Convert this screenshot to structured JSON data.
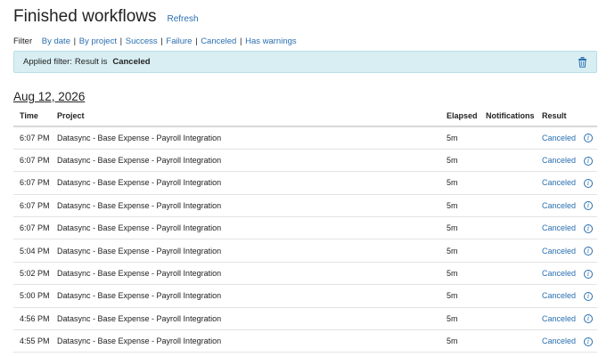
{
  "header": {
    "title": "Finished workflows",
    "refresh_label": "Refresh"
  },
  "filter": {
    "label": "Filter",
    "options": [
      "By date",
      "By project",
      "Success",
      "Failure",
      "Canceled",
      "Has warnings"
    ]
  },
  "applied_filter": {
    "prefix": "Applied filter:",
    "field": "Result is",
    "value": "Canceled",
    "remove_icon": "trash-icon"
  },
  "date_heading": "Aug 12, 2026",
  "table": {
    "columns": [
      "Time",
      "Project",
      "Elapsed",
      "Notifications",
      "Result"
    ],
    "rows": [
      {
        "time": "6:07 PM",
        "project": "Datasync - Base Expense - Payroll Integration",
        "elapsed": "5m",
        "notifications": "",
        "result": "Canceled"
      },
      {
        "time": "6:07 PM",
        "project": "Datasync - Base Expense - Payroll Integration",
        "elapsed": "5m",
        "notifications": "",
        "result": "Canceled"
      },
      {
        "time": "6:07 PM",
        "project": "Datasync - Base Expense - Payroll Integration",
        "elapsed": "5m",
        "notifications": "",
        "result": "Canceled"
      },
      {
        "time": "6:07 PM",
        "project": "Datasync - Base Expense - Payroll Integration",
        "elapsed": "5m",
        "notifications": "",
        "result": "Canceled"
      },
      {
        "time": "6:07 PM",
        "project": "Datasync - Base Expense - Payroll Integration",
        "elapsed": "5m",
        "notifications": "",
        "result": "Canceled"
      },
      {
        "time": "5:04 PM",
        "project": "Datasync - Base Expense - Payroll Integration",
        "elapsed": "5m",
        "notifications": "",
        "result": "Canceled"
      },
      {
        "time": "5:02 PM",
        "project": "Datasync - Base Expense - Payroll Integration",
        "elapsed": "5m",
        "notifications": "",
        "result": "Canceled"
      },
      {
        "time": "5:00 PM",
        "project": "Datasync - Base Expense - Payroll Integration",
        "elapsed": "5m",
        "notifications": "",
        "result": "Canceled"
      },
      {
        "time": "4:56 PM",
        "project": "Datasync - Base Expense - Payroll Integration",
        "elapsed": "5m",
        "notifications": "",
        "result": "Canceled"
      },
      {
        "time": "4:55 PM",
        "project": "Datasync - Base Expense - Payroll Integration",
        "elapsed": "5m",
        "notifications": "",
        "result": "Canceled"
      }
    ]
  },
  "icons": {
    "row_info": "info-icon"
  },
  "colors": {
    "link": "#2a6fb0",
    "applied_bg": "#d8eef3"
  }
}
